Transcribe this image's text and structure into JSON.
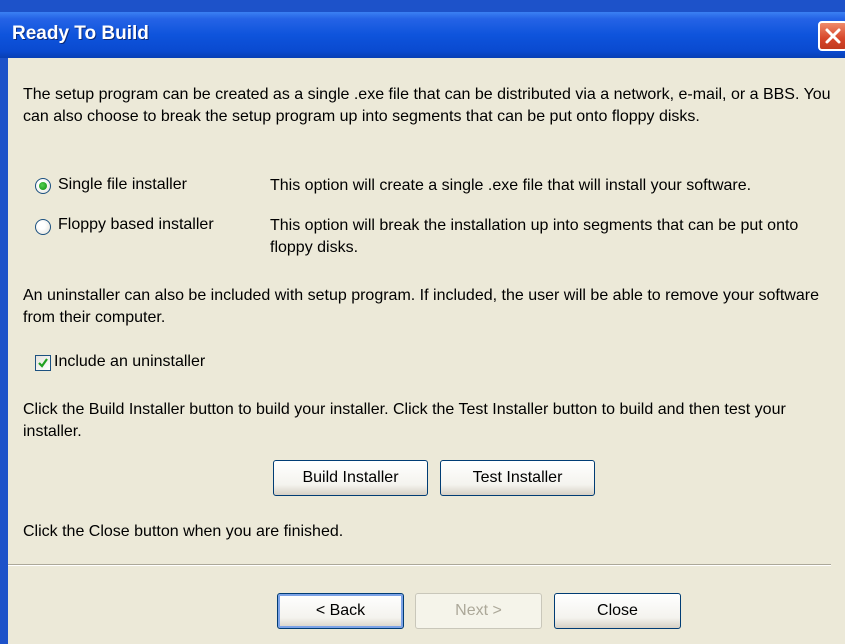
{
  "window": {
    "title": "Ready To Build"
  },
  "intro_text": "The setup program can be created as a single .exe file that can be distributed via a network, e-mail, or a BBS. You can also choose to break the setup program up into segments that can be put onto floppy disks.",
  "options": [
    {
      "label": "Single file installer",
      "description": "This option will create a single .exe file that will install your software.",
      "selected": true
    },
    {
      "label": "Floppy based installer",
      "description": "This option will break the installation up into segments that can be put onto floppy disks.",
      "selected": false
    }
  ],
  "uninstaller_text": "An uninstaller can also be included with setup program. If included, the user will be able to remove your software from their computer.",
  "uninstaller_checkbox": {
    "label": "Include an uninstaller",
    "checked": true
  },
  "build_text": "Click the Build Installer button to build your installer. Click the Test Installer button to build and then test your installer.",
  "build_buttons": {
    "build_label": "Build Installer",
    "test_label": "Test Installer"
  },
  "close_text": "Click the Close button when you are finished.",
  "nav_buttons": {
    "back_label": "< Back",
    "next_label": "Next >",
    "close_label": "Close"
  },
  "colors": {
    "title_bar": "#0a4ad0",
    "dialog_background": "#ece9d8",
    "radio_dot": "#21a121",
    "check_mark": "#21a121",
    "close_button": "#d7462a"
  },
  "icons": {
    "close": "close-x-icon",
    "radio_selected": "radio-selected-icon",
    "check": "checkmark-icon"
  }
}
